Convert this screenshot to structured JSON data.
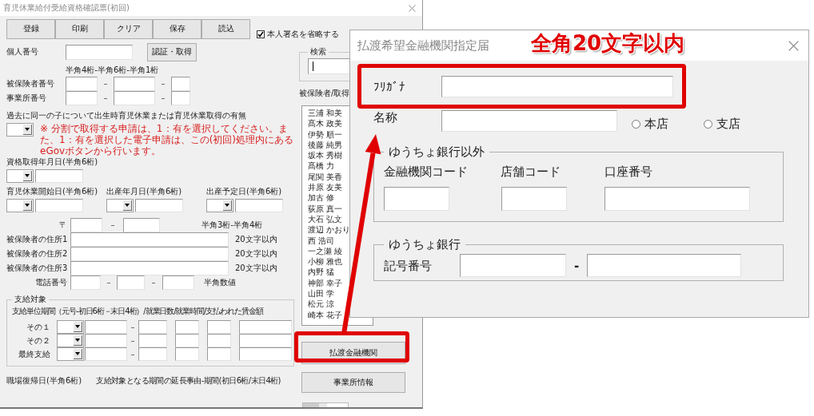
{
  "main_window": {
    "title": "育児休業給付受給資格確認票(初回)",
    "toolbar": [
      "登録",
      "印刷",
      "クリア",
      "保存",
      "読込"
    ],
    "checkbox": {
      "label": "本人署名を省略する",
      "checked": true
    },
    "personal_number": {
      "label": "個人番号",
      "button": "認証・取得"
    },
    "number_hint": "半角4桁-半角6桁-半角1桁",
    "number_rows": [
      {
        "label": "被保険者番号",
        "separators": [
          "–",
          "–"
        ]
      },
      {
        "label": "事業所番号",
        "separators": [
          "–",
          "–"
        ]
      }
    ],
    "previous_leave": {
      "label": "過去に同一の子について出生時育児休業または育児休業取得の有無",
      "note": "※ 分割で取得する申請は、1：有を選択してください。また、1：有を選択した電子申請は、この(初回)処理内にあるeGovボタンから行います。"
    },
    "acquisition_date": "資格取得年月日(半角6桁)",
    "date_fields": [
      "育児休業開始日(半角6桁)",
      "出産年月日(半角6桁)",
      "出産予定日(半角6桁)"
    ],
    "postal": {
      "mark": "〒",
      "separator": "–",
      "hint": "半角3桁-半角4桁"
    },
    "addresses": [
      {
        "label": "被保険者の住所1",
        "hint": "20文字以内"
      },
      {
        "label": "被保険者の住所2",
        "hint": "20文字以内"
      },
      {
        "label": "被保険者の住所3",
        "hint": "20文字以内"
      }
    ],
    "phone": {
      "label": "電話番号",
      "separators": [
        "–",
        "–"
      ],
      "hint": "半角数値"
    },
    "payment_target": {
      "title": "支給対象",
      "heading": "支給単位期間（元号-初日6桁－末日4桁）/就業日数/就業時間/支払われた賃金額",
      "rows": [
        {
          "label": "その１",
          "separator": "–"
        },
        {
          "label": "その２",
          "separator": "–"
        },
        {
          "label": "最終支給",
          "separator": "–"
        }
      ]
    },
    "bottom_labels": [
      "職場復帰日(半角6桁)",
      "支給対象となる期間の延長事由-期間(初日6桁/末日4桁)"
    ],
    "search": {
      "title": "検索"
    },
    "list_heading": "被保険者/取得",
    "insured_list": [
      "三浦 和美",
      "髙木 政美",
      "伊勢 順一",
      "後藤 純男",
      "坂本 秀樹",
      "髙橋 力",
      "尾関 美香",
      "井原 友美",
      "加古 修",
      "荻原 真一",
      "大石 弘文",
      "渡辺 かおり",
      "西 浩司",
      "一之瀬 綾",
      "小柳 雅也",
      "内野 猛",
      "神部 幸子",
      "山田 学",
      "松元 涼",
      "崎本 花子"
    ],
    "side_buttons": [
      "払渡金融機関",
      "事業所情報"
    ]
  },
  "dialog": {
    "title": "払渡希望金融機関指定届",
    "furigana_label": "ﾌﾘｶﾞﾅ",
    "name_label": "名称",
    "branch_options": [
      {
        "label": "本店",
        "selected": false
      },
      {
        "label": "支店",
        "selected": false
      }
    ],
    "non_yucho": {
      "title": "ゆうちょ銀行以外",
      "fields": [
        "金融機関コード",
        "店舗コード",
        "口座番号"
      ]
    },
    "yucho": {
      "title": "ゆうちょ銀行",
      "label": "記号番号",
      "separator": "-"
    }
  },
  "annotation": {
    "text": "全角20文字以内"
  }
}
